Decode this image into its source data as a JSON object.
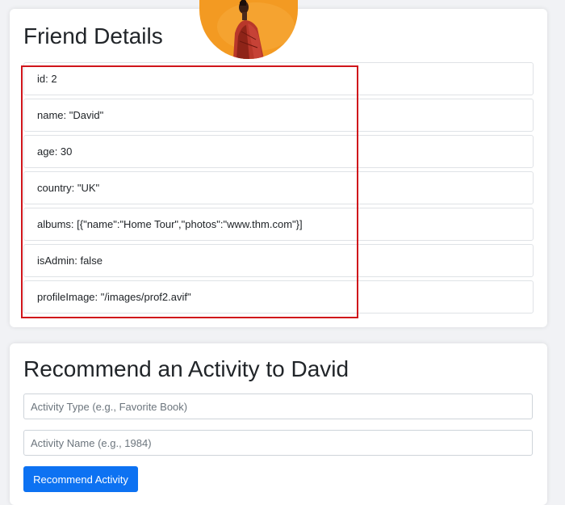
{
  "friend_card": {
    "title": "Friend Details",
    "avatar": {
      "icon": "profile-photo",
      "background": "#f39a22"
    },
    "details": [
      {
        "key": "id",
        "value": "2",
        "text": "id: 2"
      },
      {
        "key": "name",
        "value": "\"David\"",
        "text": "name: \"David\""
      },
      {
        "key": "age",
        "value": "30",
        "text": "age: 30"
      },
      {
        "key": "country",
        "value": "\"UK\"",
        "text": "country: \"UK\""
      },
      {
        "key": "albums",
        "value": "[{\"name\":\"Home Tour\",\"photos\":\"www.thm.com\"}]",
        "text": "albums: [{\"name\":\"Home Tour\",\"photos\":\"www.thm.com\"}]"
      },
      {
        "key": "isAdmin",
        "value": "false",
        "text": "isAdmin: false"
      },
      {
        "key": "profileImage",
        "value": "\"/images/prof2.avif\"",
        "text": "profileImage: \"/images/prof2.avif\""
      }
    ],
    "highlight_color": "#d0151b"
  },
  "recommend_card": {
    "title": "Recommend an Activity to David",
    "activity_type": {
      "value": "",
      "placeholder": "Activity Type (e.g., Favorite Book)"
    },
    "activity_name": {
      "value": "",
      "placeholder": "Activity Name (e.g., 1984)"
    },
    "submit_label": "Recommend Activity",
    "accent_color": "#0d72f2"
  }
}
